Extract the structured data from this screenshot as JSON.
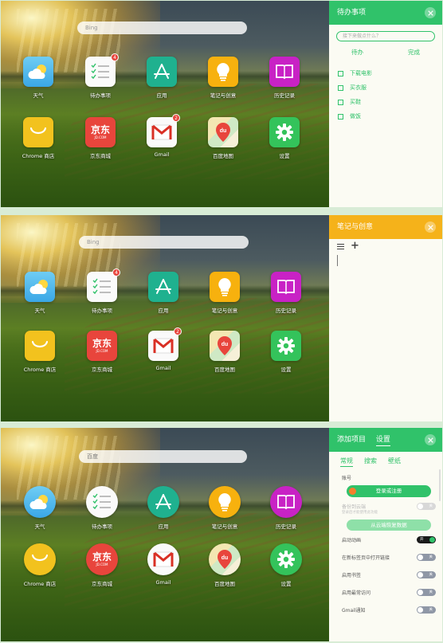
{
  "apps": [
    {
      "id": "weather",
      "label": "天气",
      "icon": "weather-icon"
    },
    {
      "id": "todo",
      "label": "待办事项",
      "icon": "checklist-icon",
      "badge": "4"
    },
    {
      "id": "apps",
      "label": "应用",
      "icon": "app-store-icon"
    },
    {
      "id": "notes",
      "label": "笔记与创意",
      "icon": "lightbulb-icon"
    },
    {
      "id": "history",
      "label": "历史记录",
      "icon": "book-icon"
    },
    {
      "id": "chrome_store",
      "label": "Chrome 商店",
      "icon": "store-bag-icon"
    },
    {
      "id": "jd",
      "label": "京东商城",
      "icon": "jd-logo-icon",
      "logo_text": "京东",
      "logo_sub": "JD.COM"
    },
    {
      "id": "gmail",
      "label": "Gmail",
      "icon": "gmail-icon",
      "badge": "2"
    },
    {
      "id": "maps",
      "label": "百度地图",
      "icon": "map-pin-icon",
      "logo_text": "du"
    },
    {
      "id": "settings",
      "label": "设置",
      "icon": "gear-icon"
    }
  ],
  "screens": [
    {
      "search_placeholder": "Bing",
      "panel": {
        "title": "待办事项",
        "input_placeholder": "接下来做点什么？",
        "tabs": [
          "待办",
          "完成"
        ],
        "tasks": [
          "下载电影",
          "买衣服",
          "买鞋",
          "做饭"
        ]
      }
    },
    {
      "search_placeholder": "Bing",
      "panel": {
        "title": "笔记与创意"
      }
    },
    {
      "search_placeholder": "百度",
      "panel": {
        "title_tabs": [
          "添加项目",
          "设置"
        ],
        "subtabs": [
          "常规",
          "搜索",
          "壁纸"
        ],
        "account_label": "账号",
        "login_button": "登录或注册",
        "backup_label": "备份到云端",
        "backup_hint": "登录后才能使用此功能",
        "restore_button": "从云端恢复数据",
        "settings": [
          {
            "label": "启动动画",
            "state": "开"
          },
          {
            "label": "在新标签页中打开链接",
            "state": "关"
          },
          {
            "label": "启用书签",
            "state": "关"
          },
          {
            "label": "启用最常访问",
            "state": "关"
          },
          {
            "label": "Gmail通知",
            "state": "关"
          }
        ],
        "backup_state": "关"
      }
    }
  ],
  "colors": {
    "green": "#30c26a",
    "yellow": "#f5b21a"
  }
}
